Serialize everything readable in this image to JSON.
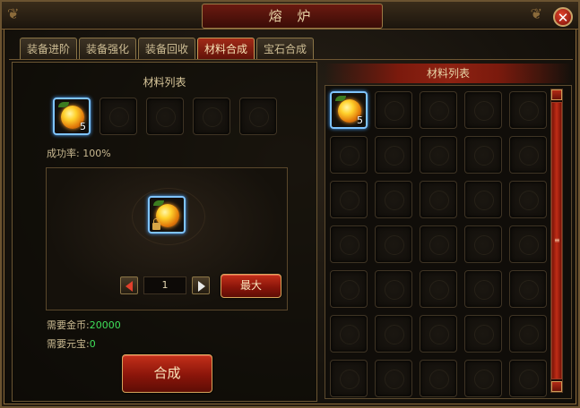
{
  "window": {
    "title": "熔 炉"
  },
  "tabs": [
    {
      "label": "装备进阶",
      "active": false
    },
    {
      "label": "装备强化",
      "active": false
    },
    {
      "label": "装备回收",
      "active": false
    },
    {
      "label": "材料合成",
      "active": true
    },
    {
      "label": "宝石合成",
      "active": false
    }
  ],
  "left": {
    "section_title": "材料列表",
    "slots": [
      {
        "item": "orange-gem-orb-icon",
        "count": "5"
      },
      {
        "item": null,
        "count": ""
      },
      {
        "item": null,
        "count": ""
      },
      {
        "item": null,
        "count": ""
      },
      {
        "item": null,
        "count": ""
      }
    ],
    "success_rate_label": "成功率: 100%",
    "quantity": "1",
    "max_button": "最大",
    "gold_label": "需要金币:",
    "gold_value": "20000",
    "yuanbao_label": "需要元宝:",
    "yuanbao_value": "0",
    "combine_button": "合成"
  },
  "right": {
    "section_title": "材料列表",
    "grid_rows": 7,
    "grid_cols": 5,
    "items": [
      {
        "index": 0,
        "item": "orange-gem-orb-icon",
        "count": "5"
      }
    ]
  },
  "colors": {
    "accent_red": "#8a150a",
    "gold_text": "#c9b991",
    "green_value": "#3fe05a",
    "select_blue": "#7fc4ff"
  }
}
